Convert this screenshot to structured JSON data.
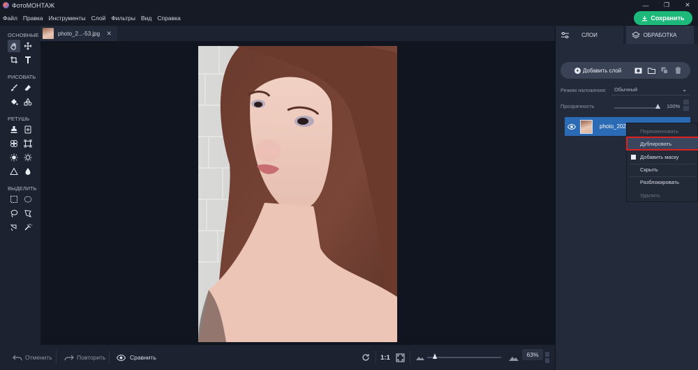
{
  "app": {
    "title": "ФотоМОНТАЖ"
  },
  "menu": [
    "Файл",
    "Правка",
    "Инструменты",
    "Слой",
    "Фильтры",
    "Вид",
    "Справка"
  ],
  "save_label": "Сохранить",
  "colors": {
    "accent": "#1cb97a",
    "selection": "#2b6bb6",
    "highlight_border": "#e02020"
  },
  "tools": {
    "groups": [
      {
        "title": "ОСНОВНЫЕ"
      },
      {
        "title": "РИСОВАТЬ"
      },
      {
        "title": "РЕТУШЬ"
      },
      {
        "title": "ВЫДЕЛИТЬ"
      }
    ]
  },
  "document": {
    "tab_name": "photo_2...-53.jpg",
    "close": "✕"
  },
  "bottom": {
    "undo": "Отменить",
    "redo": "Повторить",
    "compare": "Сравнить",
    "ratio": "1:1",
    "zoom": "63%"
  },
  "panel": {
    "tab_layers": "СЛОИ",
    "tab_processing": "ОБРАБОТКА",
    "add_layer": "Добавить слой",
    "blend_label": "Режим наложения:",
    "blend_value": "Обычный",
    "opacity_label": "Прозрачность",
    "opacity_value": "100%",
    "layer_name": "photo_2025"
  },
  "context_menu": {
    "items": [
      {
        "label": "Переименовать",
        "state": "disabled"
      },
      {
        "label": "Дублировать",
        "state": "highlighted"
      },
      {
        "label": "Добавить маску",
        "state": "checked"
      },
      {
        "label": "Скрыть",
        "state": "normal"
      },
      {
        "label": "Разблокировать",
        "state": "normal"
      },
      {
        "label": "Удалить",
        "state": "disabled"
      }
    ]
  }
}
